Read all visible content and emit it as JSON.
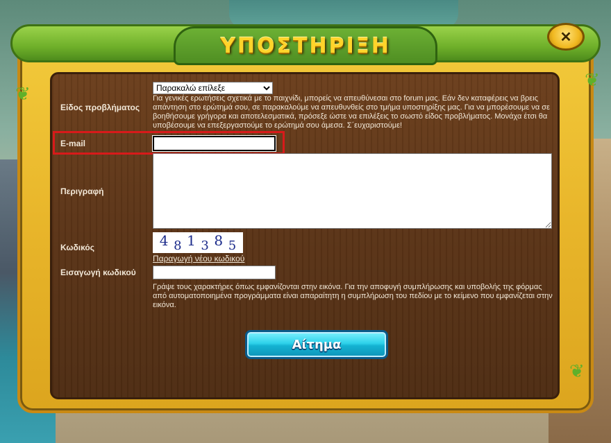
{
  "window": {
    "title": "ΥΠΟΣΤΗΡΙΞΗ",
    "close_label": "✕"
  },
  "form": {
    "problem_type": {
      "label": "Είδος προβλήματος",
      "selected": "Παρακαλώ επίλεξε",
      "help": "Για γενικές ερωτήσεις σχετικά με το παιχνίδι, μπορείς να απευθύνεσαι στο forum μας. Εάν δεν καταφέρεις να βρεις απάντηση στο ερώτημά σου, σε παρακαλούμε να απευθυνθείς στο τμήμα υποστηρίξης μας. Για να μπορέσουμε να σε βοηθήσουμε γρήγορα και αποτελεσματικά, πρόσεξε ώστε να επιλέξεις το σωστό είδος προβλήματος. Μονάχα έτσι θα υποβέσουμε να επεξεργαστούμε το ερώτημά σου άμεσα. Σ΄ευχαριστούμε!"
    },
    "email": {
      "label": "E-mail",
      "value": ""
    },
    "description": {
      "label": "Περιγραφή",
      "value": ""
    },
    "captcha": {
      "label": "Κωδικός",
      "digits": [
        "4",
        "8",
        "1",
        "3",
        "8",
        "5"
      ],
      "regenerate_link": "Παραγωγή νέου κωδικού"
    },
    "code_entry": {
      "label": "Εισαγωγή κωδικού",
      "value": "",
      "help": "Γράψε τους χαρακτήρες όπως εμφανίζονται στην εικόνα. Για την αποφυγή συμπλήρωσης και υποβολής της φόρμας από αυτοματοποιημένα προγράμματα είναι απαραίτητη η συμπλήρωση του πεδίου με το κείμενο που εμφανίζεται στην εικόνα."
    },
    "submit_label": "Αίτημα"
  },
  "colors": {
    "frame": "#e8b52a",
    "panel": "#5a3316",
    "title": "#ffd42a",
    "button": "#2ed2ea",
    "highlight": "#d81a1a"
  }
}
